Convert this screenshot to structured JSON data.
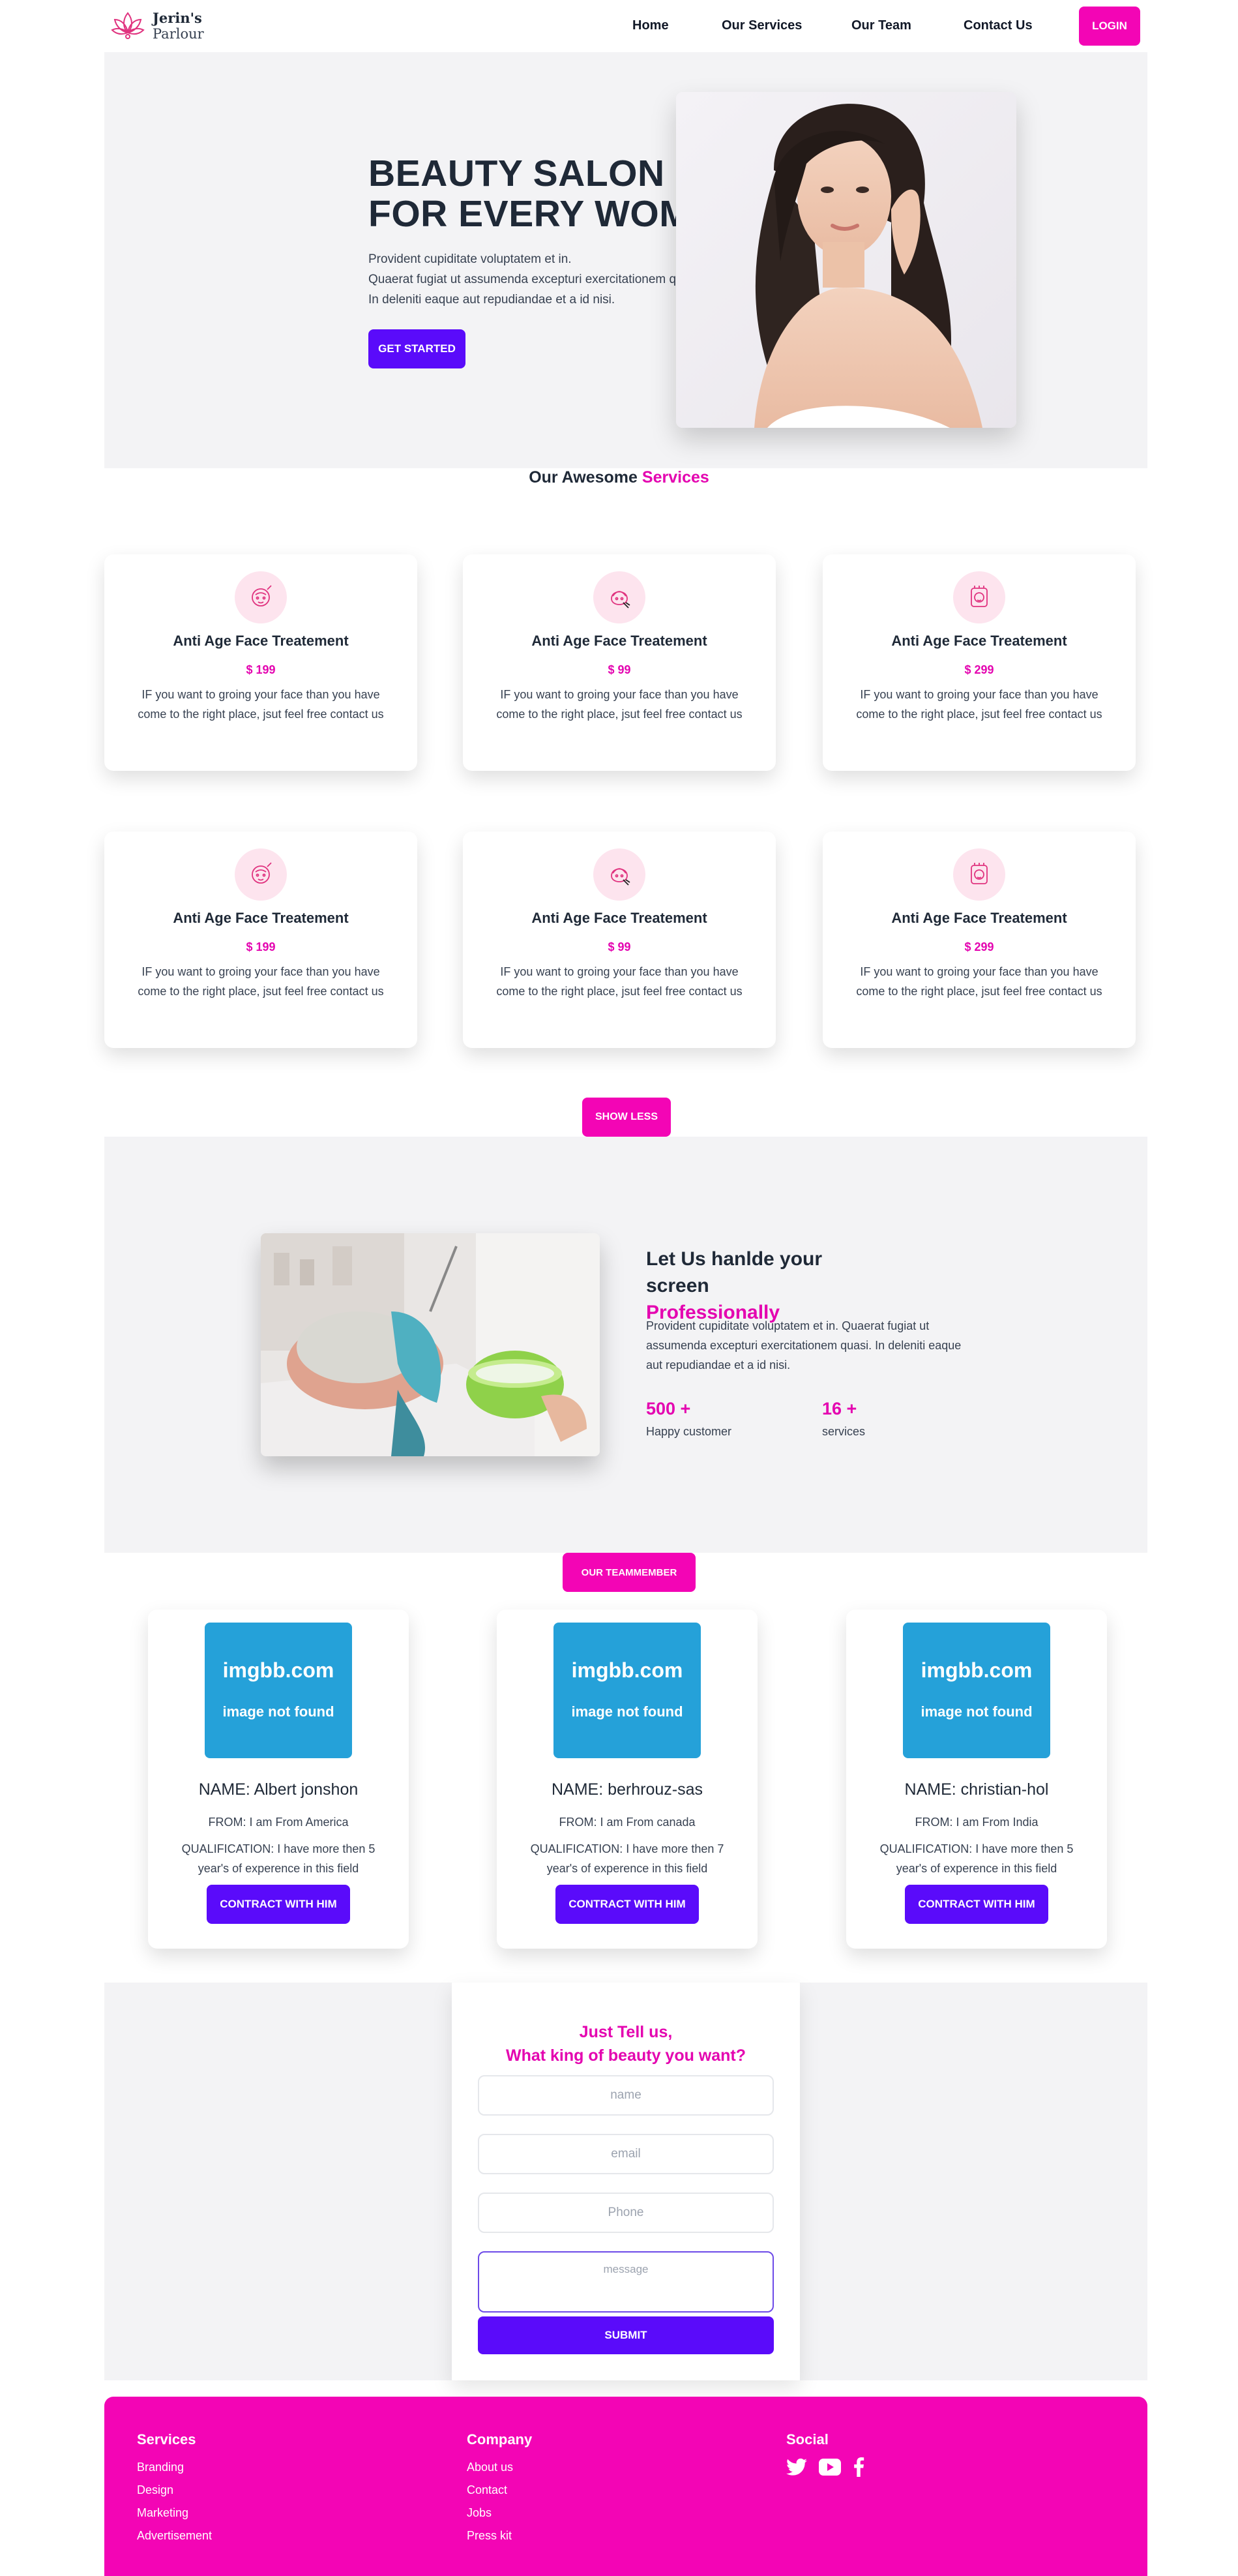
{
  "nav": {
    "logo_line1": "Jerin's",
    "logo_line2": "Parlour",
    "links": [
      "Home",
      "Our Services",
      "Our Team",
      "Contact Us"
    ],
    "login": "LOGIN"
  },
  "hero": {
    "title_line1": "BEAUTY SALON",
    "title_line2": "FOR EVERY WOMEN",
    "desc": [
      "Provident cupiditate voluptatem et in.",
      "Quaerat fugiat ut assumenda excepturi exercitationem quasi.",
      "In deleniti eaque aut repudiandae et a id nisi."
    ],
    "button": "GET STARTED"
  },
  "services": {
    "title_a": "Our Awesome",
    "title_b": "Services",
    "cards": [
      {
        "icon": "face-mask-icon",
        "title": "Anti Age Face Treatement",
        "price": "$ 199",
        "desc": "IF you want to groing your face than you have come to the right place, jsut feel free contact us"
      },
      {
        "icon": "face-massage-icon",
        "title": "Anti Age Face Treatement",
        "price": "$ 99",
        "desc": "IF you want to groing your face than you have come to the right place, jsut feel free contact us"
      },
      {
        "icon": "hair-care-icon",
        "title": "Anti Age Face Treatement",
        "price": "$ 299",
        "desc": "IF you want to groing your face than you have come to the right place, jsut feel free contact us"
      },
      {
        "icon": "face-mask-icon",
        "title": "Anti Age Face Treatement",
        "price": "$ 199",
        "desc": "IF you want to groing your face than you have come to the right place, jsut feel free contact us"
      },
      {
        "icon": "face-massage-icon",
        "title": "Anti Age Face Treatement",
        "price": "$ 99",
        "desc": "IF you want to groing your face than you have come to the right place, jsut feel free contact us"
      },
      {
        "icon": "hair-care-icon",
        "title": "Anti Age Face Treatement",
        "price": "$ 299",
        "desc": "IF you want to groing your face than you have come to the right place, jsut feel free contact us"
      }
    ],
    "toggle": "SHOW LESS"
  },
  "about": {
    "title_line1": "Let Us hanlde your",
    "title_line2a": "screen",
    "title_line2b": "Professionally",
    "desc": "Provident cupiditate voluptatem et in. Quaerat fugiat ut assumenda excepturi exercitationem quasi. In deleniti eaque aut repudiandae et a id nisi.",
    "stats": [
      {
        "num": "500 +",
        "label": "Happy customer"
      },
      {
        "num": "16 +",
        "label": "services"
      }
    ]
  },
  "team": {
    "badge": "OUR TEAMMEMBER",
    "placeholder_title": "imgbb.com",
    "placeholder_sub": "image not found",
    "button": "CONTRACT WITH HIM",
    "members": [
      {
        "name": "NAME: Albert jonshon",
        "from": "FROM: I am From America",
        "qual": "QUALIFICATION: I have more then 5 year's of experence in this field"
      },
      {
        "name": "NAME: berhrouz-sas",
        "from": "FROM: I am From canada",
        "qual": "QUALIFICATION: I have more then 7 year's of experence in this field"
      },
      {
        "name": "NAME: christian-hol",
        "from": "FROM: I am From India",
        "qual": "QUALIFICATION: I have more then 5 year's of experence in this field"
      }
    ]
  },
  "contact": {
    "title_line1": "Just Tell us,",
    "title_line2": "What king of beauty you want?",
    "placeholders": {
      "name": "name",
      "email": "email",
      "phone": "Phone",
      "message": "message"
    },
    "submit": "SUBMIT"
  },
  "footer": {
    "services_title": "Services",
    "services": [
      "Branding",
      "Design",
      "Marketing",
      "Advertisement"
    ],
    "company_title": "Company",
    "company": [
      "About us",
      "Contact",
      "Jobs",
      "Press kit"
    ],
    "social_title": "Social",
    "social_icons": [
      "twitter-icon",
      "youtube-icon",
      "facebook-icon"
    ]
  },
  "colors": {
    "accent_pink": "#f305b5",
    "accent_purple": "#5a0bfa",
    "placeholder_blue": "#25a1d9"
  }
}
